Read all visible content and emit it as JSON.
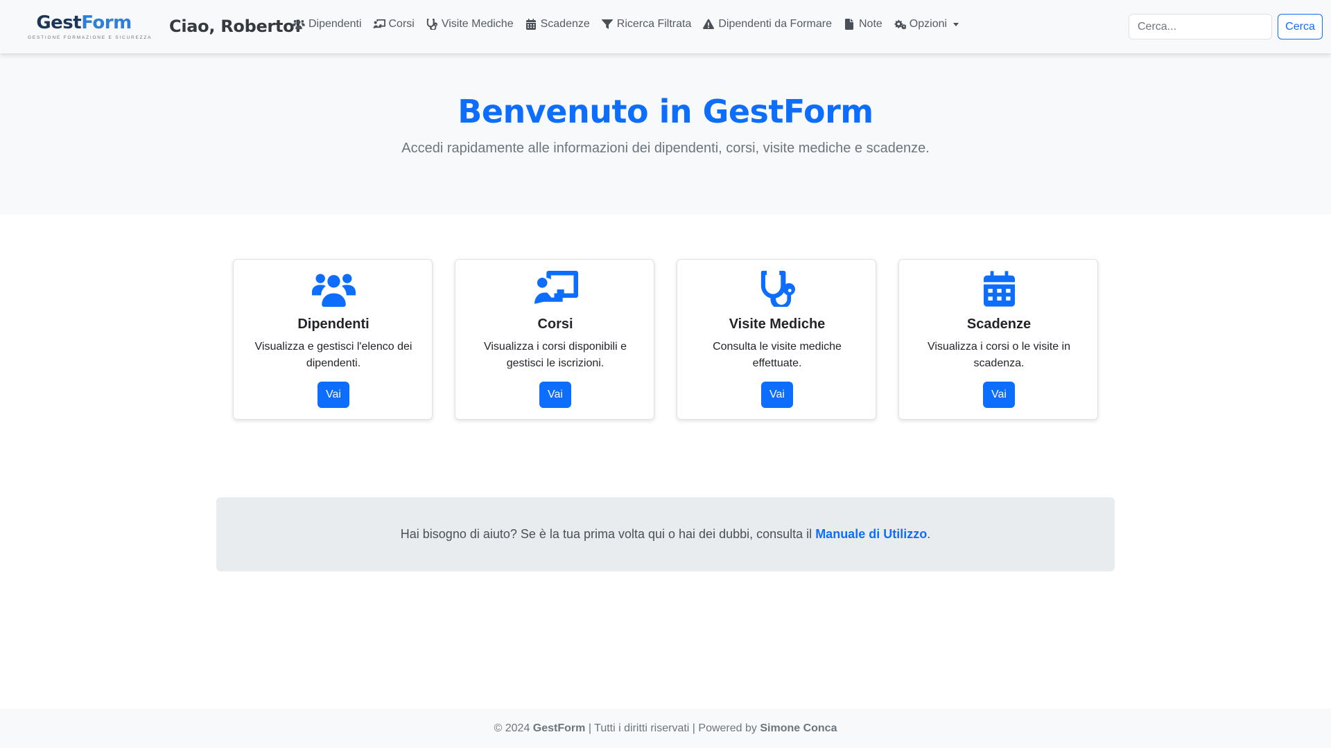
{
  "brand": {
    "part1": "Gest",
    "part2": "Form",
    "tagline": "GESTIONE FORMAZIONE E SICUREZZA"
  },
  "greeting": "Ciao, Roberto!",
  "nav": {
    "items": [
      {
        "label": "Dipendenti",
        "icon": "users-icon"
      },
      {
        "label": "Corsi",
        "icon": "chalkboard-teacher-icon"
      },
      {
        "label": "Visite Mediche",
        "icon": "stethoscope-icon"
      },
      {
        "label": "Scadenze",
        "icon": "calendar-icon"
      },
      {
        "label": "Ricerca Filtrata",
        "icon": "filter-icon"
      },
      {
        "label": "Dipendenti da Formare",
        "icon": "warning-icon"
      },
      {
        "label": "Note",
        "icon": "file-icon"
      },
      {
        "label": "Opzioni",
        "icon": "cogs-icon"
      }
    ]
  },
  "search": {
    "placeholder": "Cerca...",
    "value": "",
    "button_label": "Cerca"
  },
  "hero": {
    "title": "Benvenuto in GestForm",
    "subtitle": "Accedi rapidamente alle informazioni dei dipendenti, corsi, visite mediche e scadenze."
  },
  "cards": [
    {
      "title": "Dipendenti",
      "text": "Visualizza e gestisci l'elenco dei dipendenti.",
      "button": "Vai",
      "icon": "users-icon"
    },
    {
      "title": "Corsi",
      "text": "Visualizza i corsi disponibili e gestisci le iscrizioni.",
      "button": "Vai",
      "icon": "chalkboard-teacher-icon"
    },
    {
      "title": "Visite Mediche",
      "text": "Consulta le visite mediche effettuate.",
      "button": "Vai",
      "icon": "stethoscope-icon"
    },
    {
      "title": "Scadenze",
      "text": "Visualizza i corsi o le visite in scadenza.",
      "button": "Vai",
      "icon": "calendar-icon"
    }
  ],
  "help": {
    "text": "Hai bisogno di aiuto? Se è la tua prima volta qui o hai dei dubbi, consulta il",
    "link_label": "Manuale di Utilizzo",
    "suffix": "."
  },
  "footer": {
    "copyright": "© 2024",
    "brand": "GestForm",
    "rights": "| Tutti i diritti riservati | Powered by",
    "author": "Simone Conca"
  },
  "colors": {
    "primary": "#0d6efd",
    "navbar_bg": "#f8f9fa",
    "help_bg": "#e9ecef",
    "brand_dark": "#1d3557",
    "brand_blue": "#2f7fd6"
  }
}
